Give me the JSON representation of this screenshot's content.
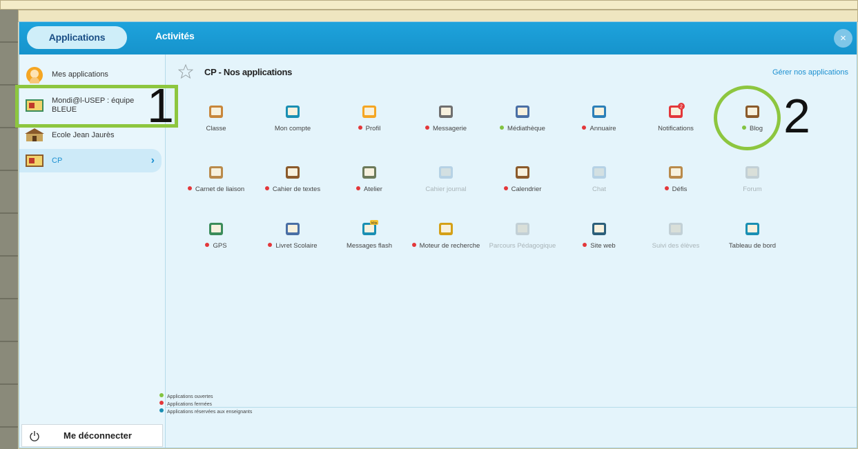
{
  "tabs": {
    "applications": "Applications",
    "activites": "Activités"
  },
  "close_icon": "×",
  "sidebar": {
    "items": [
      {
        "label": "Mes applications",
        "icon": "avatar-icon"
      },
      {
        "label": "Mondi@l-USEP : équipe BLEUE",
        "icon": "class-icon"
      },
      {
        "label": "Ecole Jean Jaurès",
        "icon": "school-icon"
      },
      {
        "label": "CP",
        "icon": "class-icon"
      }
    ],
    "active_chevron": "›",
    "logout": "Me déconnecter"
  },
  "main": {
    "title": "CP - Nos applications",
    "manage": "Gérer nos applications",
    "apps": [
      {
        "name": "Classe",
        "status": "none"
      },
      {
        "name": "Mon compte",
        "status": "none"
      },
      {
        "name": "Profil",
        "status": "closed"
      },
      {
        "name": "Messagerie",
        "status": "closed"
      },
      {
        "name": "Médiathèque",
        "status": "open"
      },
      {
        "name": "Annuaire",
        "status": "closed"
      },
      {
        "name": "Notifications",
        "status": "none",
        "badge": "2"
      },
      {
        "name": "Blog",
        "status": "open"
      },
      {
        "name": "Carnet de liaison",
        "status": "closed"
      },
      {
        "name": "Cahier de textes",
        "status": "closed"
      },
      {
        "name": "Atelier",
        "status": "closed"
      },
      {
        "name": "Cahier journal",
        "status": "disabled"
      },
      {
        "name": "Calendrier",
        "status": "closed"
      },
      {
        "name": "Chat",
        "status": "disabled"
      },
      {
        "name": "Défis",
        "status": "closed"
      },
      {
        "name": "Forum",
        "status": "disabled"
      },
      {
        "name": "GPS",
        "status": "closed"
      },
      {
        "name": "Livret Scolaire",
        "status": "closed"
      },
      {
        "name": "Messages flash",
        "status": "none",
        "badge": "bêta"
      },
      {
        "name": "Moteur de recherche",
        "status": "closed"
      },
      {
        "name": "Parcours Pédagogique",
        "status": "disabled"
      },
      {
        "name": "Site web",
        "status": "closed"
      },
      {
        "name": "Suivi des élèves",
        "status": "disabled"
      },
      {
        "name": "Tableau de bord",
        "status": "none"
      }
    ]
  },
  "legend": {
    "open": "Applications ouvertes",
    "closed": "Applications fermées",
    "teachers": "Applications réservées aux enseignants"
  },
  "annotations": {
    "one": "1",
    "two": "2"
  },
  "colors": {
    "topbar": "#1693cc",
    "accent": "#1b8fd0",
    "open": "#82c341",
    "closed": "#e3373a",
    "teachers": "#1a8fb3",
    "highlight": "#8dc63f"
  }
}
